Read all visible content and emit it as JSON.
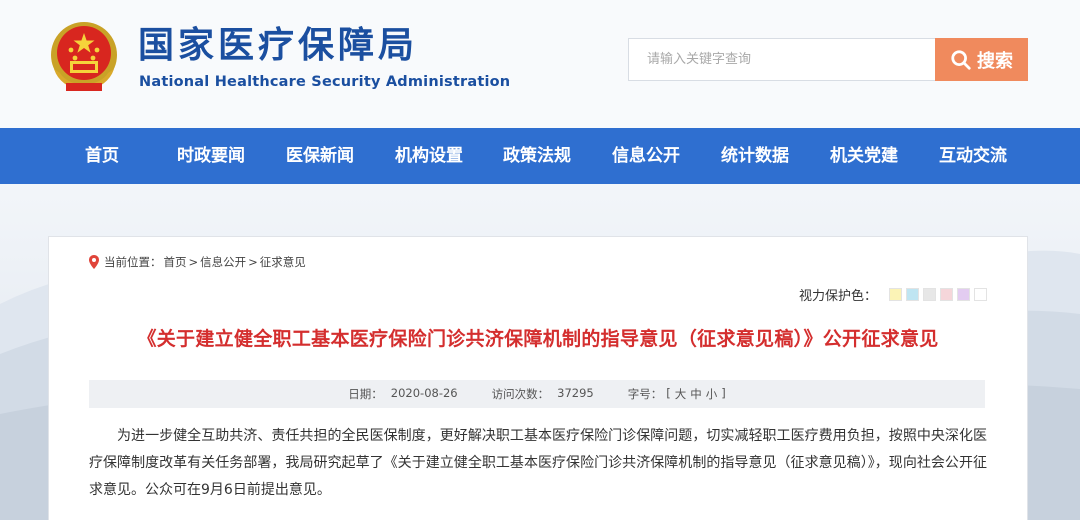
{
  "header": {
    "title_cn": "国家医疗保障局",
    "title_en": "National Healthcare Security Administration",
    "emblem_icon": "national-emblem-icon"
  },
  "search": {
    "placeholder": "请输入关键字查询",
    "button_label": "搜索",
    "button_color": "#f08a5d"
  },
  "nav": {
    "color": "#2f6fd0",
    "items": [
      {
        "label": "首页"
      },
      {
        "label": "时政要闻"
      },
      {
        "label": "医保新闻"
      },
      {
        "label": "机构设置"
      },
      {
        "label": "政策法规"
      },
      {
        "label": "信息公开"
      },
      {
        "label": "统计数据"
      },
      {
        "label": "机关党建"
      },
      {
        "label": "互动交流"
      }
    ]
  },
  "breadcrumb": {
    "prefix": "当前位置：",
    "items": [
      "首页",
      "信息公开",
      "征求意见"
    ],
    "separator": ">"
  },
  "eye_care": {
    "label": "视力保护色：",
    "swatches": [
      "#fbf3b6",
      "#bfe5f2",
      "#e7e7e7",
      "#f5d6da",
      "#e3ccf1",
      "#ffffff"
    ]
  },
  "article": {
    "title": "《关于建立健全职工基本医疗保险门诊共济保障机制的指导意见（征求意见稿）》公开征求意见",
    "title_color": "#d42e2e",
    "date_label": "日期：",
    "date": "2020-08-26",
    "visits_label": "访问次数：",
    "visits": "37295",
    "font_label": "字号：",
    "font_bracket_open": "[",
    "font_large": "大",
    "font_medium": "中",
    "font_small": "小",
    "font_bracket_close": "]",
    "body": "为进一步健全互助共济、责任共担的全民医保制度，更好解决职工基本医疗保险门诊保障问题，切实减轻职工医疗费用负担，按照中央深化医疗保障制度改革有关任务部署，我局研究起草了《关于建立健全职工基本医疗保险门诊共济保障机制的指导意见（征求意见稿）》，现向社会公开征求意见。公众可在9月6日前提出意见。"
  }
}
